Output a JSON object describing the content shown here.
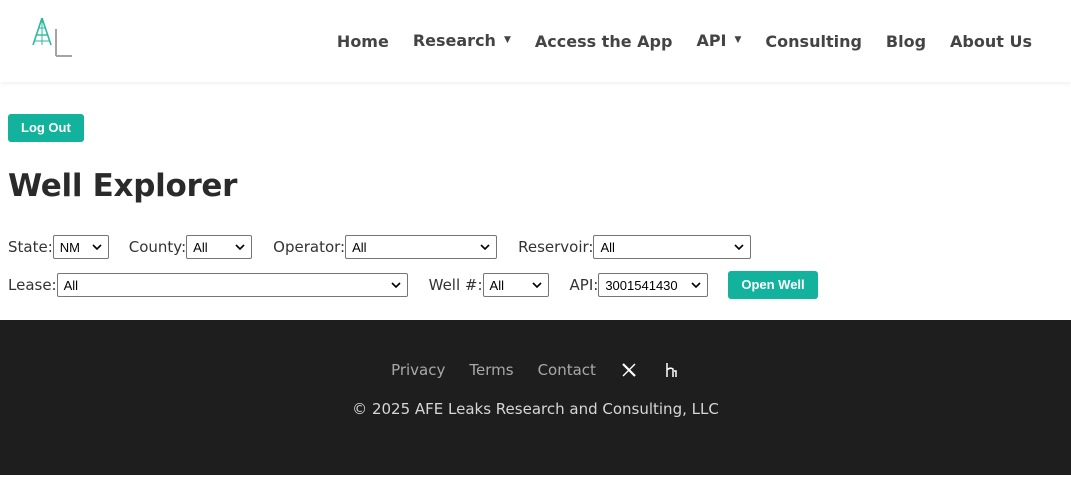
{
  "nav": {
    "items": [
      {
        "label": "Home",
        "dropdown": false
      },
      {
        "label": "Research",
        "dropdown": true
      },
      {
        "label": "Access the App",
        "dropdown": false
      },
      {
        "label": "API",
        "dropdown": true
      },
      {
        "label": "Consulting",
        "dropdown": false
      },
      {
        "label": "Blog",
        "dropdown": false
      },
      {
        "label": "About Us",
        "dropdown": false
      }
    ]
  },
  "logout_label": "Log Out",
  "title": "Well Explorer",
  "filters": {
    "state": {
      "label": "State:",
      "value": "NM"
    },
    "county": {
      "label": "County:",
      "value": "All"
    },
    "operator": {
      "label": "Operator:",
      "value": "All"
    },
    "reservoir": {
      "label": "Reservoir:",
      "value": "All"
    },
    "lease": {
      "label": "Lease:",
      "value": "All"
    },
    "well": {
      "label": "Well #:",
      "value": "All"
    },
    "api": {
      "label": "API:",
      "value": "3001541430"
    }
  },
  "open_well_label": "Open Well",
  "footer": {
    "links": [
      "Privacy",
      "Terms",
      "Contact"
    ],
    "icons": [
      "x-icon",
      "github-icon"
    ],
    "copyright": "© 2025 AFE Leaks Research and Consulting, LLC"
  },
  "colors": {
    "accent": "#13b29c",
    "footer_bg": "#1e1e1e",
    "logo": "#2fb8a0"
  }
}
